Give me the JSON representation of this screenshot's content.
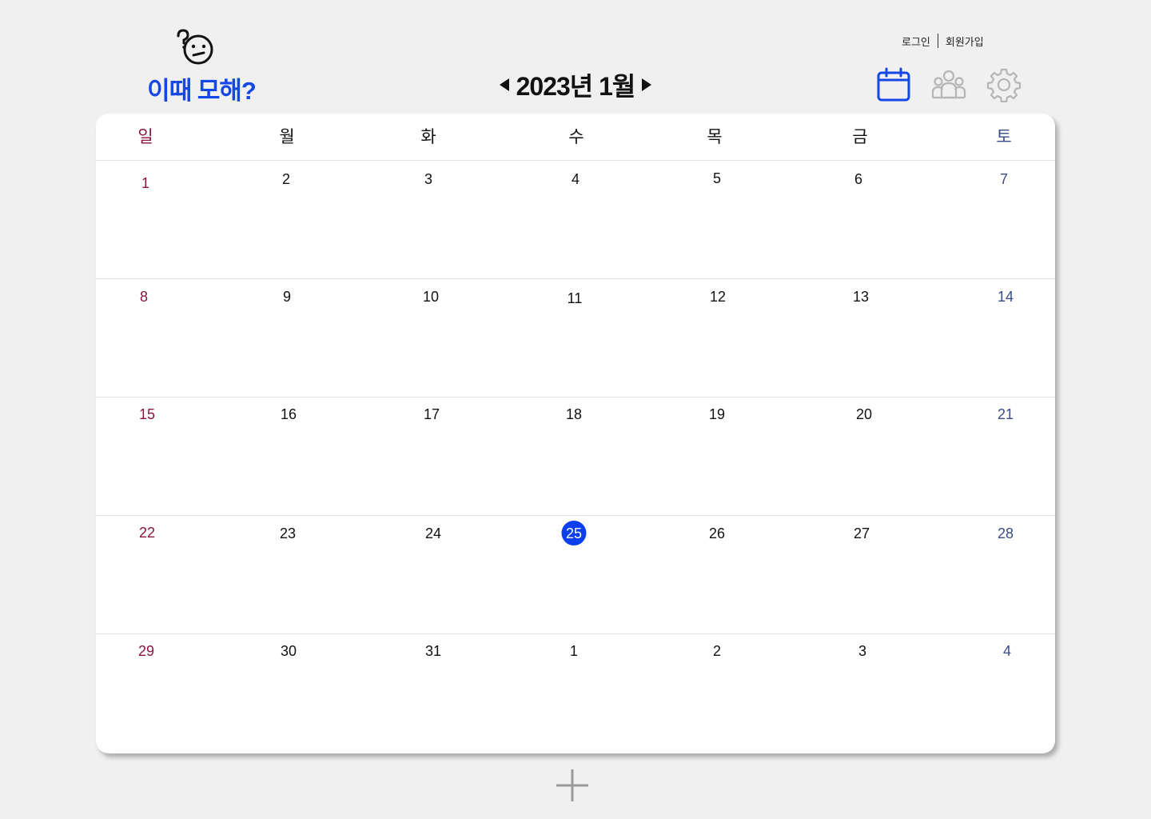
{
  "header": {
    "logo_title": "이때 모해?",
    "logo_icon": "confused-face-icon",
    "month_label": "2023년 1월",
    "prev_icon": "triangle-left-icon",
    "next_icon": "triangle-right-icon",
    "login": "로그인",
    "signup": "회원가입"
  },
  "toolbar": {
    "calendar_icon": "calendar-icon",
    "group_icon": "group-icon",
    "settings_icon": "gear-icon"
  },
  "colors": {
    "accent": "#1447e6",
    "today": "#0b3ff0",
    "sunday": "#8b1440",
    "saturday": "#3b4a8a",
    "inactive_icon": "#b5b5b5"
  },
  "weekdays": [
    "일",
    "월",
    "화",
    "수",
    "목",
    "금",
    "토"
  ],
  "weeks": [
    [
      "1",
      "2",
      "3",
      "4",
      "5",
      "6",
      "7"
    ],
    [
      "8",
      "9",
      "10",
      "11",
      "12",
      "13",
      "14"
    ],
    [
      "15",
      "16",
      "17",
      "18",
      "19",
      "20",
      "21"
    ],
    [
      "22",
      "23",
      "24",
      "25",
      "26",
      "27",
      "28"
    ],
    [
      "29",
      "30",
      "31",
      "1",
      "2",
      "3",
      "4"
    ]
  ],
  "today": "25",
  "add_icon": "plus-icon"
}
